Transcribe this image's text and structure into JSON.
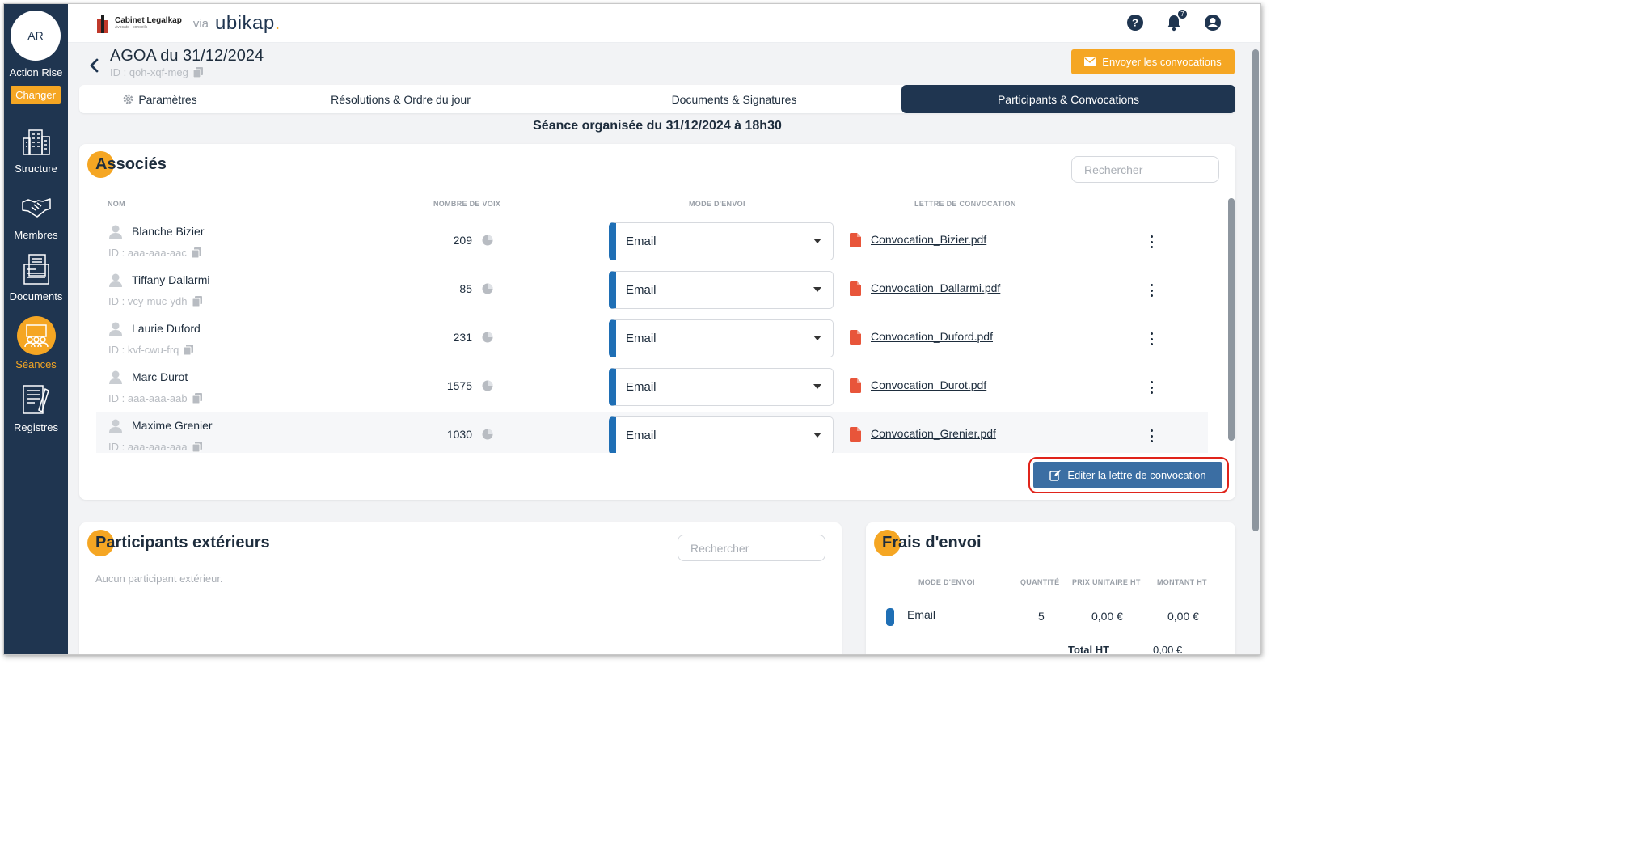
{
  "sidebar": {
    "avatar_initials": "AR",
    "company_name": "Action Rise",
    "change_label": "Changer",
    "items": [
      {
        "label": "Structure",
        "icon": "building-icon",
        "active": false
      },
      {
        "label": "Membres",
        "icon": "handshake-icon",
        "active": false
      },
      {
        "label": "Documents",
        "icon": "documents-icon",
        "active": false
      },
      {
        "label": "Séances",
        "icon": "meeting-icon",
        "active": true
      },
      {
        "label": "Registres",
        "icon": "register-icon",
        "active": false
      }
    ]
  },
  "topbar": {
    "cabinet_name": "Cabinet Legalkap",
    "cabinet_sub": "Avocats - conseils",
    "via": "via",
    "app_name": "ubikap",
    "app_dot": ".",
    "notification_count": "7",
    "icons": [
      "help-icon",
      "bell-icon",
      "user-icon"
    ]
  },
  "header": {
    "title": "AGOA du 31/12/2024",
    "id": "ID : qoh-xqf-meg",
    "send_button": "Envoyer les convocations"
  },
  "tabs": [
    {
      "label": "Paramètres",
      "icon": "gear-icon",
      "active": false
    },
    {
      "label": "Résolutions & Ordre du jour",
      "active": false
    },
    {
      "label": "Documents & Signatures",
      "active": false
    },
    {
      "label": "Participants & Convocations",
      "active": true
    }
  ],
  "session_line": "Séance organisée du 31/12/2024 à 18h30",
  "associes": {
    "title": "Associés",
    "search_placeholder": "Rechercher",
    "columns": [
      "Nom",
      "Nombre de voix",
      "Mode d'envoi",
      "Lettre de convocation"
    ],
    "rows": [
      {
        "name": "Blanche Bizier",
        "id": "ID : aaa-aaa-aac",
        "votes": "209",
        "mode": "Email",
        "letter": "Convocation_Bizier.pdf"
      },
      {
        "name": "Tiffany Dallarmi",
        "id": "ID : vcy-muc-ydh",
        "votes": "85",
        "mode": "Email",
        "letter": "Convocation_Dallarmi.pdf"
      },
      {
        "name": "Laurie Duford",
        "id": "ID : kvf-cwu-frq",
        "votes": "231",
        "mode": "Email",
        "letter": "Convocation_Duford.pdf"
      },
      {
        "name": "Marc Durot",
        "id": "ID : aaa-aaa-aab",
        "votes": "1575",
        "mode": "Email",
        "letter": "Convocation_Durot.pdf"
      },
      {
        "name": "Maxime Grenier",
        "id": "ID : aaa-aaa-aaa",
        "votes": "1030",
        "mode": "Email",
        "letter": "Convocation_Grenier.pdf"
      }
    ],
    "edit_button": "Editer la lettre de convocation"
  },
  "exterieurs": {
    "title": "Participants extérieurs",
    "search_placeholder": "Rechercher",
    "empty": "Aucun participant extérieur."
  },
  "frais": {
    "title": "Frais d'envoi",
    "columns": [
      "Mode d'envoi",
      "Quantité",
      "Prix unitaire HT",
      "Montant HT"
    ],
    "rows": [
      {
        "mode": "Email",
        "quantity": "5",
        "unit_price": "0,00 €",
        "amount": "0,00 €"
      }
    ],
    "total_label": "Total HT",
    "total_value": "0,00 €"
  },
  "colors": {
    "navy": "#1f3550",
    "orange": "#f5a623",
    "blue_accent": "#1f6fb5",
    "button_blue": "#3b6ea3",
    "highlight_red": "#e0241b"
  }
}
